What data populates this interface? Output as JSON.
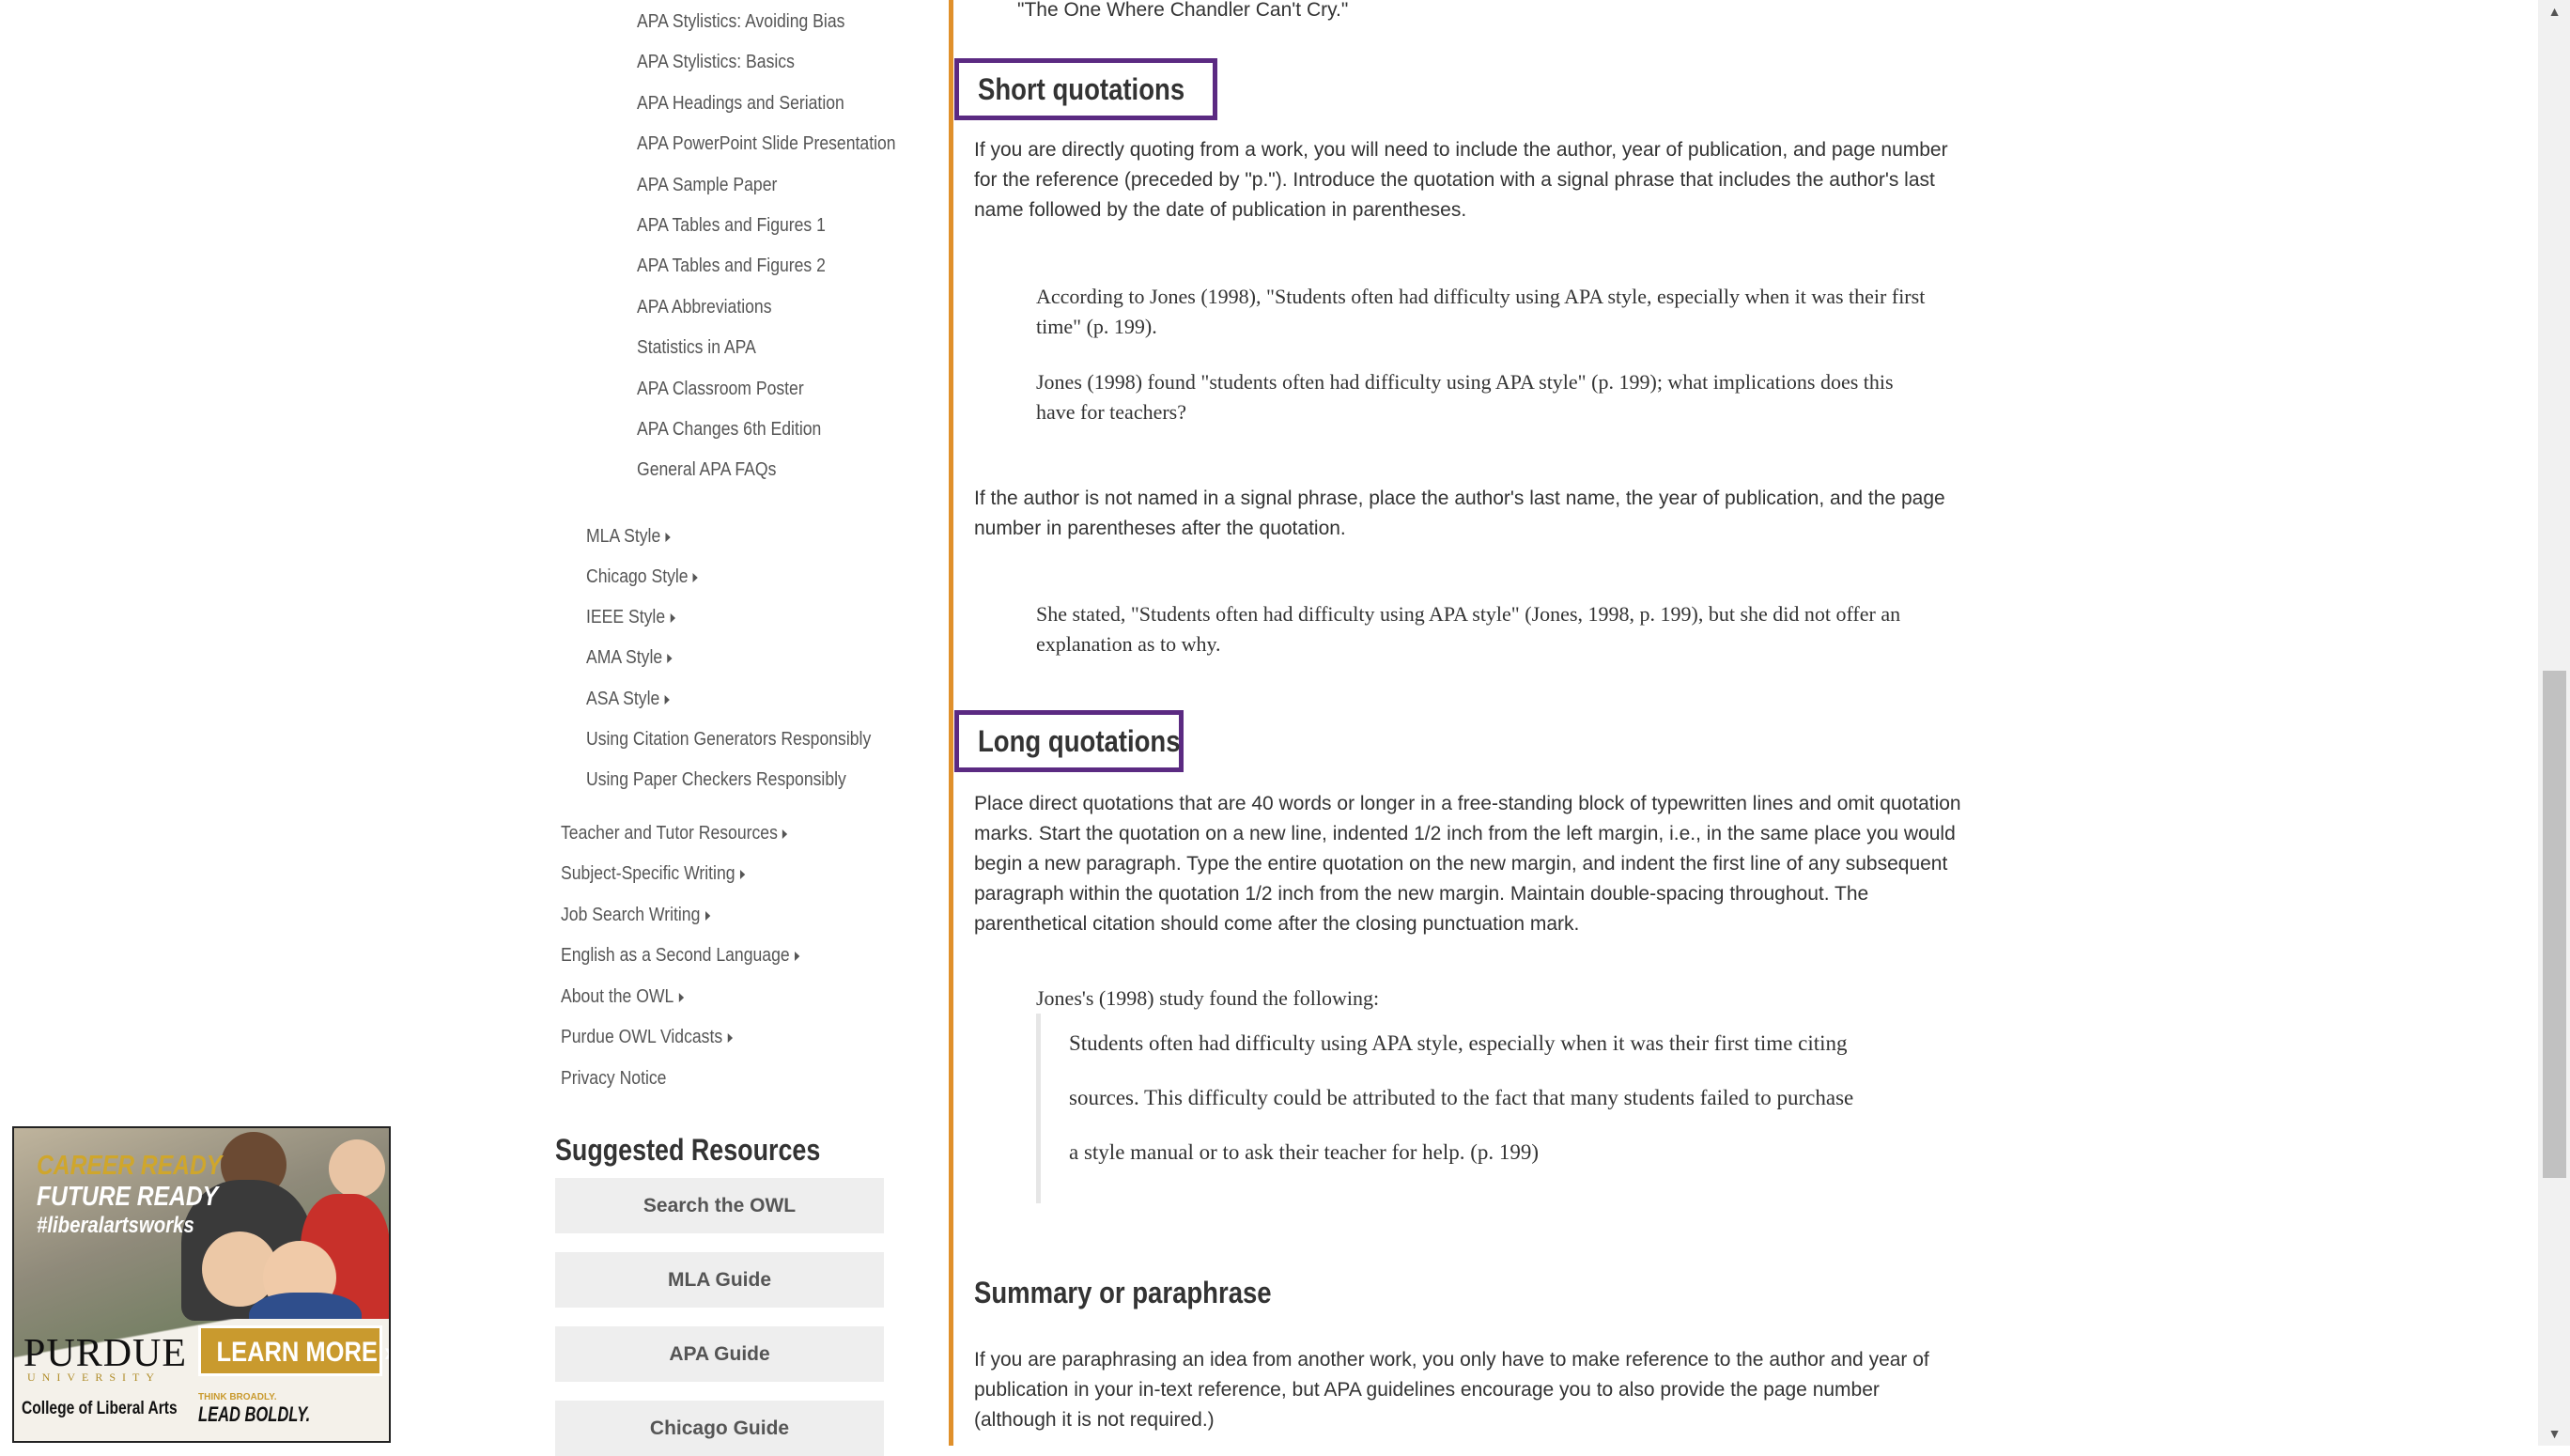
{
  "nav": {
    "apa_items": [
      "APA Stylistics: Avoiding Bias",
      "APA Stylistics: Basics",
      "APA Headings and Seriation",
      "APA PowerPoint Slide Presentation",
      "APA Sample Paper",
      "APA Tables and Figures 1",
      "APA Tables and Figures 2",
      "APA Abbreviations",
      "Statistics in APA",
      "APA Classroom Poster",
      "APA Changes 6th Edition",
      "General APA FAQs"
    ],
    "style_items": [
      "MLA Style",
      "Chicago Style",
      "IEEE Style",
      "AMA Style",
      "ASA Style",
      "Using Citation Generators Responsibly",
      "Using Paper Checkers Responsibly"
    ],
    "top_items": [
      "Teacher and Tutor Resources",
      "Subject-Specific Writing",
      "Job Search Writing",
      "English as a Second Language",
      "About the OWL",
      "Purdue OWL Vidcasts",
      "Privacy Notice"
    ]
  },
  "suggested": {
    "heading": "Suggested Resources",
    "buttons": [
      "Search the OWL",
      "MLA Guide",
      "APA Guide",
      "Chicago Guide"
    ]
  },
  "ad": {
    "line1": "CAREER READY",
    "line2": "FUTURE READY",
    "line3": "#liberalartsworks",
    "brand": "PURDUE",
    "university": "UNIVERSITY",
    "college": "College of Liberal Arts",
    "cta": "LEARN MORE ›",
    "tagline_small": "THINK BROADLY.",
    "tagline_big": "LEAD BOLDLY."
  },
  "content": {
    "top_quote": "\"The One Where Chandler Can't Cry.\"",
    "short": {
      "heading": "Short quotations",
      "para1_lines": [
        "If you are directly quoting from a work, you will need to include the author, year of publication, and page number",
        "for the reference (preceded by \"p.\"). Introduce the quotation with a signal phrase that includes the author's last",
        "name followed by the date of publication in parentheses."
      ],
      "example1_lines": [
        "According to Jones (1998), \"Students often had difficulty using APA style, especially when it was their first",
        "time\" (p. 199)."
      ],
      "example2_lines": [
        "Jones (1998) found \"students often had difficulty using APA style\" (p. 199); what implications does this",
        "have for teachers?"
      ],
      "para2_lines": [
        "If the author is not named in a signal phrase, place the author's last name, the year of publication, and the page",
        "number in parentheses after the quotation."
      ],
      "example3_lines": [
        "She stated, \"Students often had difficulty using APA style\" (Jones, 1998, p. 199), but she did not offer an",
        "explanation as to why."
      ]
    },
    "long": {
      "heading": "Long quotations",
      "para_lines": [
        "Place direct quotations that are 40 words or longer in a free-standing block of typewritten lines and omit quotation",
        "marks. Start the quotation on a new line, indented 1/2 inch from the left margin, i.e., in the same place you would",
        "begin a new paragraph. Type the entire quotation on the new margin, and indent the first line of any subsequent",
        "paragraph within the quotation 1/2 inch from the new margin. Maintain double-spacing throughout. The",
        "parenthetical citation should come after the closing punctuation mark."
      ],
      "intro": "Jones's (1998) study found the following:",
      "blockquote_lines": [
        "Students often had difficulty using APA style, especially when it was their first time citing",
        "sources. This difficulty could be attributed to the fact that many students failed to purchase",
        "a style manual or to ask their teacher for help. (p. 199)"
      ]
    },
    "summary": {
      "heading": "Summary or paraphrase",
      "para_lines": [
        "If you are paraphrasing an idea from another work, you only have to make reference to the author and year of",
        "publication in your in-text reference, but APA guidelines encourage you to also provide the page number",
        "(although it is not required.)"
      ]
    }
  },
  "colors": {
    "accent_gold": "#e0902b",
    "heading_box_purple": "#5b2a82",
    "button_bg": "#eeeeee"
  },
  "icons": {
    "nav_caret": "caret-right-icon",
    "scroll_up": "scroll-up-arrow-icon",
    "scroll_down": "scroll-down-arrow-icon"
  }
}
